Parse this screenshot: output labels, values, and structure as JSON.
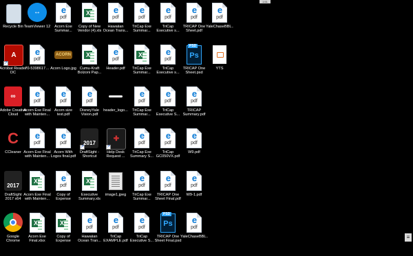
{
  "top_widget": {
    "label": "1:51"
  },
  "side_tab": {
    "label": "≡"
  },
  "icons": [
    {
      "name": "recycle-bin",
      "label": "Recycle Bin",
      "type": "recycle",
      "col": 0,
      "row": 0,
      "shortcut": false
    },
    {
      "name": "teamviewer",
      "label": "TeamViewer 12",
      "type": "teamviewer",
      "col": 1,
      "row": 0,
      "shortcut": false
    },
    {
      "name": "acorn-exe-summar",
      "label": "Acorn Exe\nSummar...",
      "type": "pdf",
      "col": 2,
      "row": 0,
      "shortcut": false
    },
    {
      "name": "copy-of-new-vendor",
      "label": "Copy of New\nVendor (4).xls",
      "type": "xls",
      "col": 3,
      "row": 0,
      "shortcut": false
    },
    {
      "name": "hawaiian-ocean-trans",
      "label": "Hawaiian\nOcean Trans...",
      "type": "pdf",
      "col": 4,
      "row": 0,
      "shortcut": false
    },
    {
      "name": "tricap-exe-summar-1",
      "label": "TriCap Exe\nSummar...",
      "type": "pdf",
      "col": 5,
      "row": 0,
      "shortcut": false
    },
    {
      "name": "tricap-executive-s-1",
      "label": "TriCap\nExecutive s...",
      "type": "pdf",
      "col": 6,
      "row": 0,
      "shortcut": false
    },
    {
      "name": "tricap-one-sheet-pdf",
      "label": "TRICAP One\nSheet.pdf",
      "type": "pdf",
      "col": 7,
      "row": 0,
      "shortcut": false
    },
    {
      "name": "yalechasebbl-1",
      "label": "YaleChaseBBL...",
      "type": "pdf",
      "col": 8,
      "row": 0,
      "shortcut": false
    },
    {
      "name": "acrobat-reader-dc",
      "label": "Acrobat Reader\nDC",
      "type": "acrobat",
      "col": 0,
      "row": 1,
      "shortcut": true
    },
    {
      "name": "file-70-5398",
      "label": "70-5398617…",
      "type": "pdf",
      "col": 1,
      "row": 1,
      "shortcut": false
    },
    {
      "name": "acorn-logo-jpg",
      "label": "Acorn Logo.jpg",
      "type": "acorn",
      "col": 2,
      "row": 1,
      "shortcut": false
    },
    {
      "name": "cumu-kraft-bolzoni",
      "label": "Cumu-Kraft\nBolzoni Pap...",
      "type": "xls",
      "col": 3,
      "row": 1,
      "shortcut": false
    },
    {
      "name": "header-pdf",
      "label": "Header.pdf",
      "type": "pdf",
      "col": 4,
      "row": 1,
      "shortcut": false
    },
    {
      "name": "tricap-exe-summar-2",
      "label": "TriCap Exe\nSummar...",
      "type": "xls",
      "col": 5,
      "row": 1,
      "shortcut": false
    },
    {
      "name": "tricap-executive-s-2",
      "label": "TriCap\nExecutive s...",
      "type": "pdf",
      "col": 6,
      "row": 1,
      "shortcut": false
    },
    {
      "name": "tricap-one-sheet-psd-1",
      "label": "TRICAP One\nSheet.psd",
      "type": "psd",
      "col": 7,
      "row": 1,
      "shortcut": false
    },
    {
      "name": "yts",
      "label": "YTS",
      "type": "blank",
      "col": 8,
      "row": 1,
      "shortcut": false
    },
    {
      "name": "adobe-creative-cloud",
      "label": "Adobe Creative\nCloud",
      "type": "cc",
      "col": 0,
      "row": 2,
      "shortcut": false
    },
    {
      "name": "acorn-exe-final-mainten-1",
      "label": "Acorn Exe Final\nwith Mainten...",
      "type": "pdf",
      "col": 1,
      "row": 2,
      "shortcut": false
    },
    {
      "name": "acorn-size-test",
      "label": "Acorn size\ntest.pdf",
      "type": "pdf",
      "col": 2,
      "row": 2,
      "shortcut": false
    },
    {
      "name": "disneyyale-vision",
      "label": "DisneyYale\nVision.pdf",
      "type": "pdf",
      "col": 3,
      "row": 2,
      "shortcut": false
    },
    {
      "name": "header-logo",
      "label": "header_logo...",
      "type": "logo",
      "col": 4,
      "row": 2,
      "shortcut": false
    },
    {
      "name": "tricap-exe-summar-3",
      "label": "TriCap Exe\nSummar...",
      "type": "pdf",
      "col": 5,
      "row": 2,
      "shortcut": false
    },
    {
      "name": "tricap-executive-s-3",
      "label": "TriCap\nExecutive S...",
      "type": "pdf",
      "col": 6,
      "row": 2,
      "shortcut": false
    },
    {
      "name": "tricap-summary",
      "label": "TRICAP\nSummary.pdf",
      "type": "pdf",
      "col": 7,
      "row": 2,
      "shortcut": false
    },
    {
      "name": "ccleaner",
      "label": "CCleaner",
      "type": "ccleaner",
      "col": 0,
      "row": 3,
      "shortcut": false
    },
    {
      "name": "acorn-exe-final-mainten-2",
      "label": "Acorn Exe Final\nwith Mainten...",
      "type": "pdf",
      "col": 1,
      "row": 3,
      "shortcut": false
    },
    {
      "name": "acorn-with-logos-final",
      "label": "Acorn With\nLogos final.pdf",
      "type": "pdf",
      "col": 2,
      "row": 3,
      "shortcut": false
    },
    {
      "name": "draftsight-shortcut",
      "label": "DraftSight -\nShortcut",
      "type": "draftsight",
      "col": 3,
      "row": 3,
      "shortcut": true
    },
    {
      "name": "help-desk-request",
      "label": "Help Desk\nRequest ...",
      "type": "helpdesk",
      "col": 4,
      "row": 3,
      "shortcut": true
    },
    {
      "name": "tricap-exe-summary-s",
      "label": "TriCap Exe\nSummary S...",
      "type": "pdf",
      "col": 5,
      "row": 3,
      "shortcut": false
    },
    {
      "name": "tricap-gc050vx",
      "label": "TriCap\nGC050VX.pdf",
      "type": "pdf",
      "col": 6,
      "row": 3,
      "shortcut": false
    },
    {
      "name": "w9-pdf",
      "label": "W9.pdf",
      "type": "pdf",
      "col": 7,
      "row": 3,
      "shortcut": false
    },
    {
      "name": "draftsight-2017",
      "label": "DraftSight\n2017 x64",
      "type": "draftsight",
      "col": 0,
      "row": 4,
      "shortcut": false
    },
    {
      "name": "acorn-exe-final-mainten-3",
      "label": "Acorn Exe Final\nwith Mainten...",
      "type": "xls",
      "col": 1,
      "row": 4,
      "shortcut": false
    },
    {
      "name": "copy-of-expense-repo-1",
      "label": "Copy of\nExpense Repo...",
      "type": "pdf",
      "col": 2,
      "row": 4,
      "shortcut": false
    },
    {
      "name": "executive-summary-xls",
      "label": "Executive\nSummary.xls",
      "type": "xls",
      "col": 3,
      "row": 4,
      "shortcut": false
    },
    {
      "name": "image1-jpeg",
      "label": "image1.jpeg",
      "type": "jpg",
      "col": 4,
      "row": 4,
      "shortcut": false
    },
    {
      "name": "tricap-exe-summar-4",
      "label": "TriCap Exe\nSummar...",
      "type": "pdf",
      "col": 5,
      "row": 4,
      "shortcut": false
    },
    {
      "name": "tricap-one-sheet-final-pdf",
      "label": "TRICAP One\nSheet Final.pdf",
      "type": "pdf",
      "col": 6,
      "row": 4,
      "shortcut": false
    },
    {
      "name": "w9-1-pdf",
      "label": "W9-1.pdf",
      "type": "pdf",
      "col": 7,
      "row": 4,
      "shortcut": false
    },
    {
      "name": "google-chrome",
      "label": "Google\nChrome",
      "type": "chrome",
      "col": 0,
      "row": 5,
      "shortcut": false
    },
    {
      "name": "acorn-exe-final-xlsx",
      "label": "Acorn Exe\nFinal.xlsx",
      "type": "xls",
      "col": 1,
      "row": 5,
      "shortcut": false
    },
    {
      "name": "copy-of-expense-repo-2",
      "label": "Copy of\nExpense Repo...",
      "type": "xls",
      "col": 2,
      "row": 5,
      "shortcut": false
    },
    {
      "name": "hawaiian-ocean-tran-2",
      "label": "Hawaiian\nOcean Tran...",
      "type": "pdf",
      "col": 3,
      "row": 5,
      "shortcut": false
    },
    {
      "name": "tricap-example",
      "label": "TriCap\nEXAMPLE.pdf",
      "type": "pdf",
      "col": 4,
      "row": 5,
      "shortcut": false
    },
    {
      "name": "tricap-executive-s-4",
      "label": "TriCap\nExecutive S...",
      "type": "pdf",
      "col": 5,
      "row": 5,
      "shortcut": false
    },
    {
      "name": "tricap-one-sheet-final-psd",
      "label": "TRICAP One\nSheet Final.psd",
      "type": "psd",
      "col": 6,
      "row": 5,
      "shortcut": false
    },
    {
      "name": "yalechasebbl-2",
      "label": "YaleChaseBBL...",
      "type": "pdf",
      "col": 7,
      "row": 5,
      "shortcut": false
    }
  ],
  "glyph_text": {
    "pdf": "pdf",
    "psd_tag": "PSD",
    "psd": "Ps",
    "xls": "X",
    "acorn": "ACORN",
    "draftsight_year": "2017",
    "shortcut": "↗"
  }
}
